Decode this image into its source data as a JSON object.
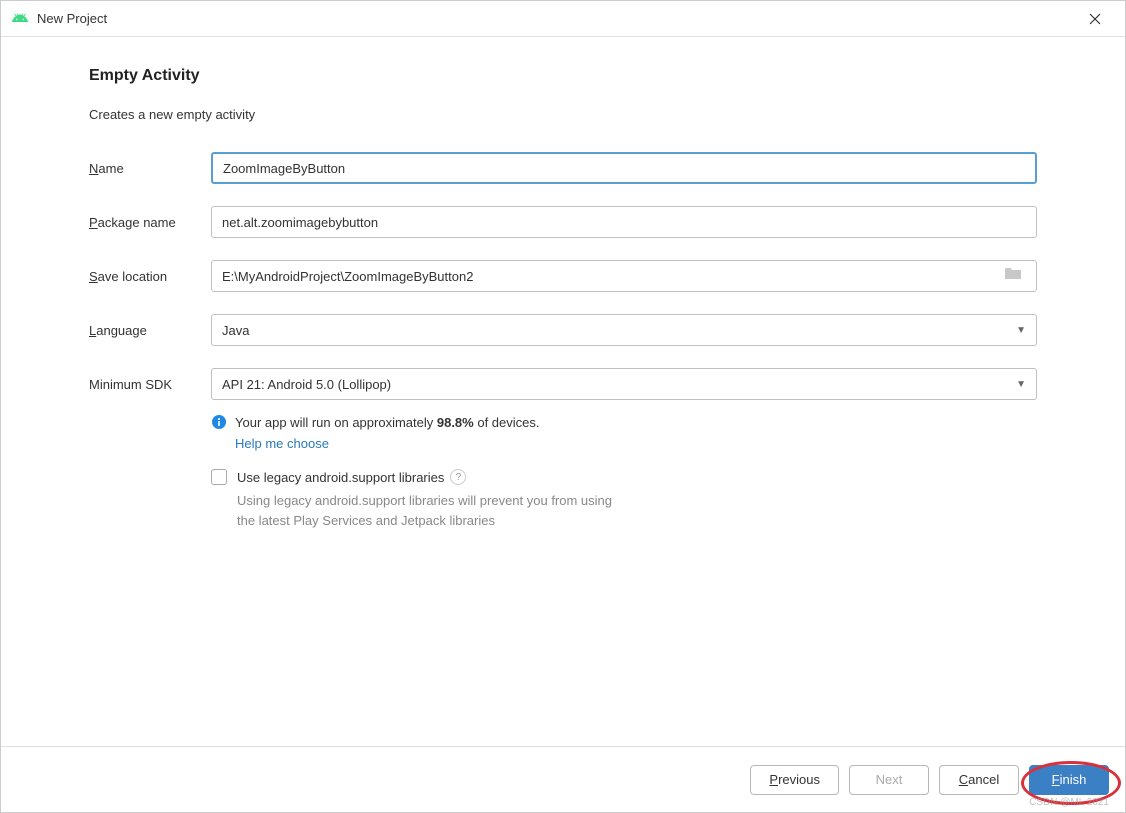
{
  "window": {
    "title": "New Project"
  },
  "heading": "Empty Activity",
  "description": "Creates a new empty activity",
  "form": {
    "name": {
      "label_pre": "N",
      "label_post": "ame",
      "value": "ZoomImageByButton"
    },
    "package_name": {
      "label_pre": "P",
      "label_post": "ackage name",
      "value": "net.alt.zoomimagebybutton"
    },
    "save_location": {
      "label_pre": "S",
      "label_post": "ave location",
      "value": "E:\\MyAndroidProject\\ZoomImageByButton2"
    },
    "language": {
      "label_pre": "L",
      "label_post": "anguage",
      "value": "Java"
    },
    "min_sdk": {
      "label": "Minimum SDK",
      "value": "API 21: Android 5.0 (Lollipop)"
    }
  },
  "info": {
    "text_pre": "Your app will run on approximately ",
    "percent": "98.8%",
    "text_post": " of devices.",
    "help_link": "Help me choose"
  },
  "legacy": {
    "checkbox_label": "Use legacy android.support libraries",
    "helper_line1": "Using legacy android.support libraries will prevent you from using",
    "helper_line2": "the latest Play Services and Jetpack libraries"
  },
  "footer": {
    "previous_pre": "P",
    "previous_post": "revious",
    "next": "Next",
    "cancel_pre": "C",
    "cancel_post": "ancel",
    "finish_pre": "F",
    "finish_post": "inish"
  },
  "watermark": "CSDN @ML 2021"
}
